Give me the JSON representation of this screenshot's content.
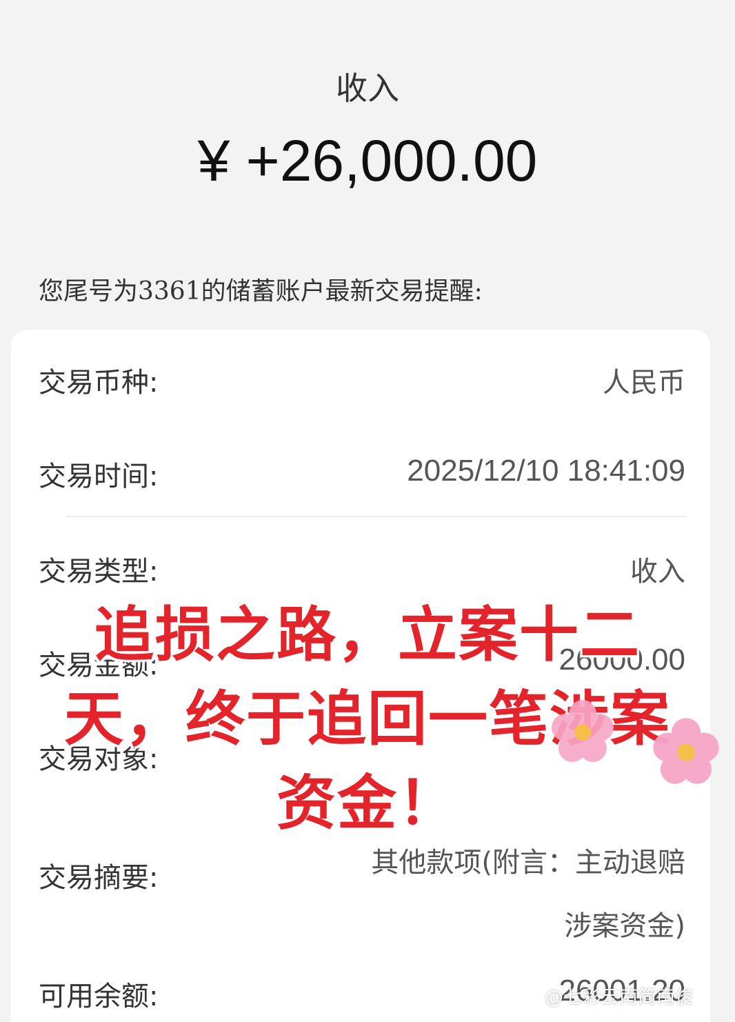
{
  "header": {
    "title": "收入",
    "amount": "¥ +26,000.00"
  },
  "notice": "您尾号为3361的储蓄账户最新交易提醒:",
  "details": {
    "currency_label": "交易币种:",
    "currency_value": "人民币",
    "time_label": "交易时间:",
    "time_value": "2025/12/10 18:41:09",
    "type_label": "交易类型:",
    "type_value": "收入",
    "amount_label": "交易金额:",
    "amount_value": "26000.00",
    "party_label": "交易对象:",
    "summary_label": "交易摘要:",
    "summary_value_line1": "其他款项(附言：主动退赔",
    "summary_value_line2": "涉案资金)",
    "balance_label": "可用余额:",
    "balance_value": "26001.20"
  },
  "overlay": {
    "line1": "追损之路，立案十二",
    "line2": "天，终于追回一笔涉案",
    "line3": "资金！",
    "color": "#e3242b"
  },
  "watermark": "@七彩云南简南俊",
  "colors": {
    "background": "#f3f3f4",
    "card": "#ffffff",
    "flower": "#f7a6c6",
    "flower_center": "#f5c04a"
  }
}
